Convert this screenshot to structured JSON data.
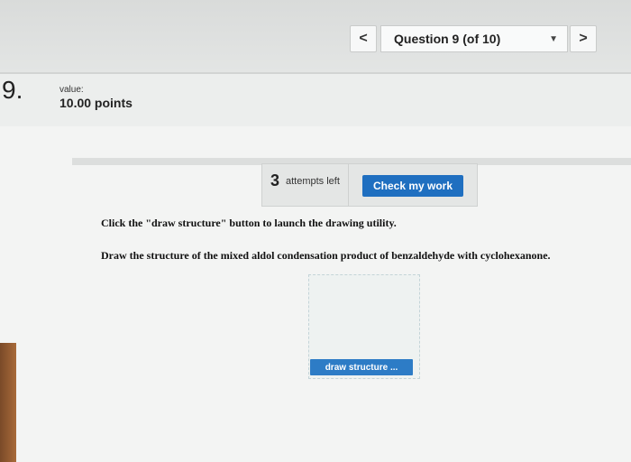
{
  "nav": {
    "prev_icon": "<",
    "next_icon": ">",
    "question_selector": "Question 9 (of 10)",
    "dropdown_caret": "▼"
  },
  "question": {
    "number": "9.",
    "value_label": "value:",
    "points": "10.00 points"
  },
  "attempts": {
    "count": "3",
    "label": "attempts left"
  },
  "buttons": {
    "check_my_work": "Check my work",
    "draw_structure": "draw structure ..."
  },
  "instructions": {
    "line1": "Click the \"draw structure\" button to launch the drawing utility.",
    "line2": "Draw the structure of the mixed aldol condensation product of benzaldehyde with cyclohexanone."
  },
  "colors": {
    "accent": "#1f6fc0"
  }
}
